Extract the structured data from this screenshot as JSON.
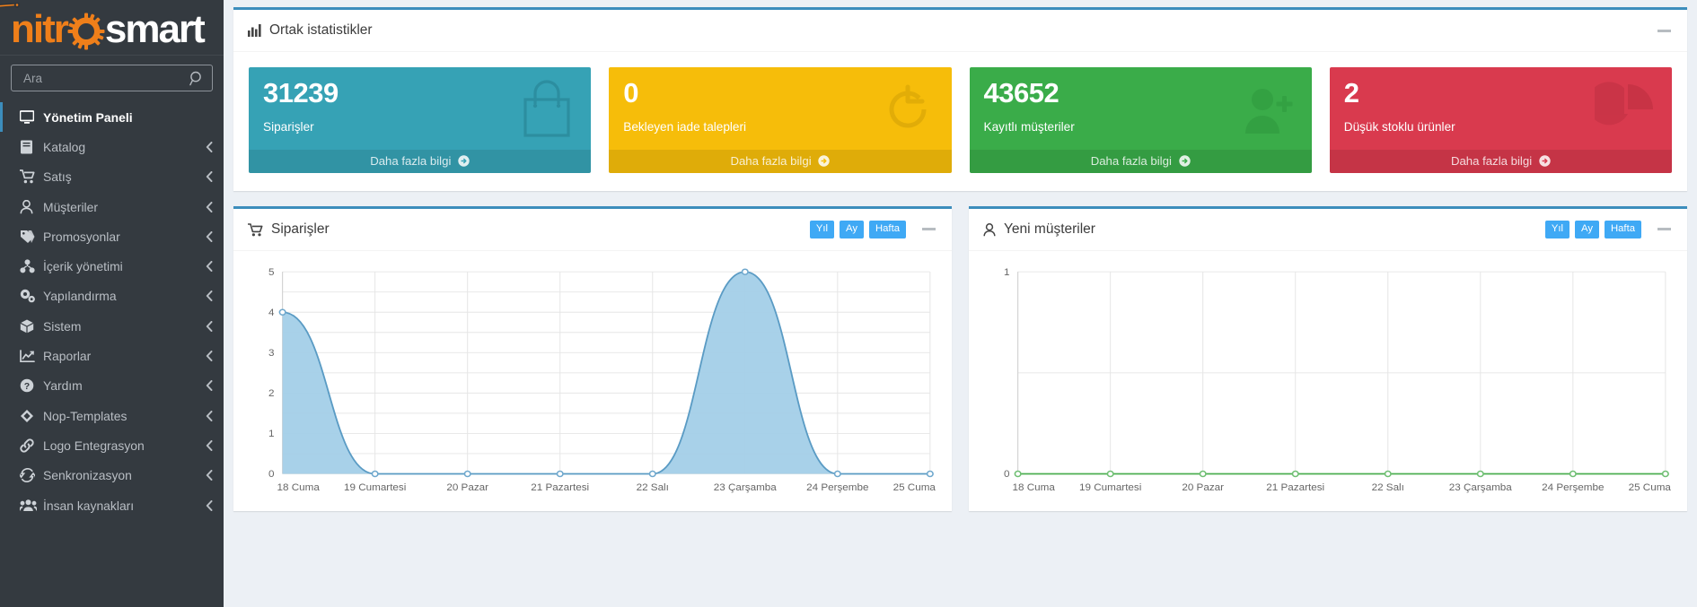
{
  "sidebar": {
    "logo": {
      "part1": "nitr",
      "part2": "smart",
      "gear_icon": "gear-icon"
    },
    "search": {
      "placeholder": "Ara",
      "value": "",
      "icon": "search-icon"
    },
    "items": [
      {
        "label": "Yönetim Paneli",
        "icon": "desktop-icon",
        "active": true,
        "arrow": false
      },
      {
        "label": "Katalog",
        "icon": "book-icon",
        "active": false,
        "arrow": true
      },
      {
        "label": "Satış",
        "icon": "cart-icon",
        "active": false,
        "arrow": true
      },
      {
        "label": "Müşteriler",
        "icon": "user-icon",
        "active": false,
        "arrow": true
      },
      {
        "label": "Promosyonlar",
        "icon": "tag-icon",
        "active": false,
        "arrow": true
      },
      {
        "label": "İçerik yönetimi",
        "icon": "sitemap-icon",
        "active": false,
        "arrow": true
      },
      {
        "label": "Yapılandırma",
        "icon": "gears-icon",
        "active": false,
        "arrow": true
      },
      {
        "label": "Sistem",
        "icon": "cube-icon",
        "active": false,
        "arrow": true
      },
      {
        "label": "Raporlar",
        "icon": "chart-line-icon",
        "active": false,
        "arrow": true
      },
      {
        "label": "Yardım",
        "icon": "question-circle-icon",
        "active": false,
        "arrow": true
      },
      {
        "label": "Nop-Templates",
        "icon": "diamond-icon",
        "active": false,
        "arrow": true
      },
      {
        "label": "Logo Entegrasyon",
        "icon": "link-icon",
        "active": false,
        "arrow": true
      },
      {
        "label": "Senkronizasyon",
        "icon": "refresh-icon",
        "active": false,
        "arrow": true
      },
      {
        "label": "İnsan kaynakları",
        "icon": "users-icon",
        "active": false,
        "arrow": true
      }
    ]
  },
  "stats_panel": {
    "title": "Ortak istatistikler",
    "title_icon": "bar-chart-icon",
    "minimize_icon": "minimize-icon",
    "more_info_label": "Daha fazla bilgi",
    "more_info_icon": "arrow-circle-right-icon",
    "cards": [
      {
        "value": "31239",
        "label": "Siparişler",
        "color": "#36a2b5",
        "theme": "c-aqua",
        "icon": "shopping-bag-icon"
      },
      {
        "value": "0",
        "label": "Bekleyen iade talepleri",
        "color": "#f6bd0a",
        "theme": "c-yellow",
        "icon": "refresh-circle-icon"
      },
      {
        "value": "43652",
        "label": "Kayıtlı müşteriler",
        "color": "#3aac49",
        "theme": "c-green",
        "icon": "user-plus-icon"
      },
      {
        "value": "2",
        "label": "Düşük stoklu ürünler",
        "color": "#d93a4e",
        "theme": "c-red",
        "icon": "pie-chart-icon"
      }
    ]
  },
  "orders_panel": {
    "title": "Siparişler",
    "title_icon": "cart-icon",
    "minimize_icon": "minimize-icon",
    "range_buttons": [
      {
        "label": "Yıl",
        "active": false
      },
      {
        "label": "Ay",
        "active": false
      },
      {
        "label": "Hafta",
        "active": true
      }
    ]
  },
  "customers_panel": {
    "title": "Yeni müşteriler",
    "title_icon": "user-icon",
    "minimize_icon": "minimize-icon",
    "range_buttons": [
      {
        "label": "Yıl",
        "active": false
      },
      {
        "label": "Ay",
        "active": false
      },
      {
        "label": "Hafta",
        "active": true
      }
    ]
  },
  "chart_data": [
    {
      "type": "area",
      "title": "Siparişler",
      "categories": [
        "18 Cuma",
        "19 Cumartesi",
        "20 Pazar",
        "21 Pazartesi",
        "22 Salı",
        "23 Çarşamba",
        "24 Perşembe",
        "25 Cuma"
      ],
      "values": [
        4,
        0,
        0,
        0,
        0,
        5,
        0,
        0
      ],
      "yticks": [
        0,
        1,
        2,
        3,
        4,
        5
      ],
      "ylim": [
        0,
        5
      ],
      "xlabel": "",
      "ylabel": "",
      "grid": true,
      "legend": "none",
      "line_color": "#5a9bc4",
      "fill_color": "#a3cfe8",
      "point_color": "#6fa8cd"
    },
    {
      "type": "line",
      "title": "Yeni müşteriler",
      "categories": [
        "18 Cuma",
        "19 Cumartesi",
        "20 Pazar",
        "21 Pazartesi",
        "22 Salı",
        "23 Çarşamba",
        "24 Perşembe",
        "25 Cuma"
      ],
      "values": [
        0,
        0,
        0,
        0,
        0,
        0,
        0,
        0
      ],
      "yticks": [
        0,
        1
      ],
      "ylim": [
        0,
        1
      ],
      "xlabel": "",
      "ylabel": "",
      "grid": true,
      "legend": "none",
      "line_color": "#4caf50",
      "fill_color": "#4caf50",
      "point_color": "#6fbf73"
    }
  ]
}
